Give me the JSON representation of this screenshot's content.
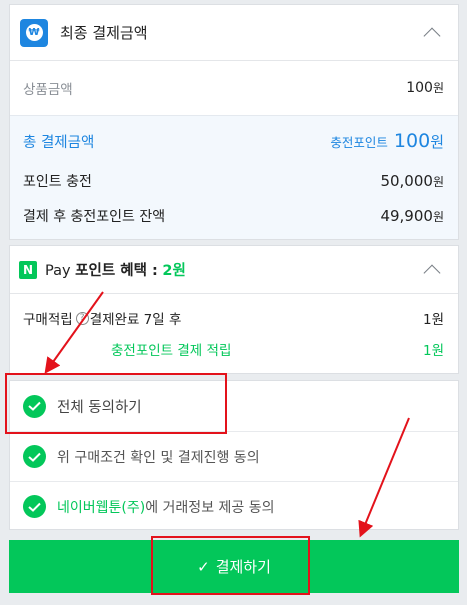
{
  "summary": {
    "title": "최종 결제금액",
    "won_symbol": "₩",
    "product_label": "상품금액",
    "product_value": "100",
    "product_unit": "원",
    "total_label": "총 결제금액",
    "total_tag": "충전포인트",
    "total_value": "100",
    "total_unit": "원",
    "charge_label": "포인트 충전",
    "charge_value": "50,000",
    "charge_unit": "원",
    "balance_label": "결제 후 충전포인트 잔액",
    "balance_value": "49,900",
    "balance_unit": "원"
  },
  "benefit": {
    "logo": "N",
    "pay_word": "Pay",
    "title": "포인트 혜택 :",
    "amount": "2원",
    "purchase_label": "구매적립",
    "help": "?",
    "purchase_when": "결제완료 7일 후",
    "purchase_value": "1원",
    "charge_label": "충전포인트 결제 적립",
    "charge_value": "1원"
  },
  "agreements": {
    "all": "전체 동의하기",
    "terms": "위 구매조건 확인 및 결제진행 동의",
    "provider_link": "네이버웹툰(주)",
    "provider_rest": "에 거래정보 제공 동의"
  },
  "pay_button": {
    "check": "✓",
    "label": "결제하기"
  },
  "colors": {
    "accent_blue": "#1e86e0",
    "brand_green": "#03c75a",
    "annotation_red": "#e3121b"
  }
}
